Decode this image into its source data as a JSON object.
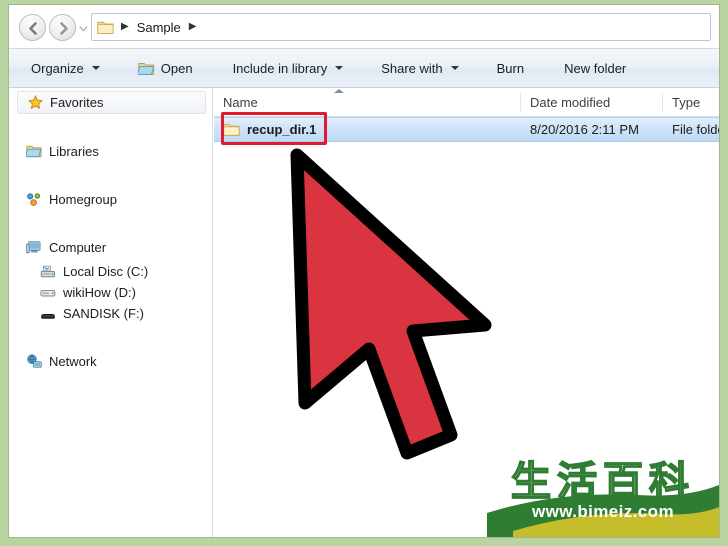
{
  "window": {
    "title": "Sample",
    "background_color": "#b9d4a0"
  },
  "address_bar": {
    "back_icon": "back-arrow-icon",
    "forward_icon": "forward-arrow-icon",
    "recent_pages_icon": "chevron-down-icon",
    "folder_icon": "folder-icon",
    "breadcrumb": [
      "Sample"
    ],
    "separator": "▶"
  },
  "toolbar": {
    "organize_label": "Organize",
    "open_label": "Open",
    "include_in_library_label": "Include in library",
    "share_with_label": "Share with",
    "burn_label": "Burn",
    "new_folder_label": "New folder",
    "open_icon": "open-folder-icon"
  },
  "sidebar": {
    "items": [
      {
        "label": "Favorites",
        "icon": "star-icon",
        "level": 0,
        "selected": true
      },
      {
        "label": "Libraries",
        "icon": "libraries-icon",
        "level": 0,
        "selected": false
      },
      {
        "label": "Homegroup",
        "icon": "homegroup-icon",
        "level": 0,
        "selected": false
      },
      {
        "label": "Computer",
        "icon": "computer-icon",
        "level": 0,
        "selected": false
      },
      {
        "label": "Local Disc (C:)",
        "icon": "hard-drive-icon",
        "level": 1,
        "selected": false
      },
      {
        "label": "wikiHow (D:)",
        "icon": "disc-drive-icon",
        "level": 1,
        "selected": false
      },
      {
        "label": "SANDISK (F:)",
        "icon": "usb-drive-icon",
        "level": 1,
        "selected": false
      },
      {
        "label": "Network",
        "icon": "network-icon",
        "level": 0,
        "selected": false
      }
    ]
  },
  "file_list": {
    "columns": [
      {
        "label": "Name",
        "sorted": true
      },
      {
        "label": "Date modified",
        "sorted": false
      },
      {
        "label": "Type",
        "sorted": false
      }
    ],
    "sort_direction": "ascending",
    "rows": [
      {
        "name": "recup_dir.1",
        "date_modified": "8/20/2016 2:11 PM",
        "type": "File folder",
        "icon": "folder-icon",
        "selected": true,
        "highlighted": true
      }
    ]
  },
  "annotations": {
    "highlight_box_color": "#e01b2e",
    "cursor": {
      "icon": "mouse-cursor-arrow",
      "fill_color": "#d9343f",
      "outline_color": "#000000"
    }
  },
  "watermark": {
    "text_cn": "生活百科",
    "url": "www.bimeiz.com",
    "swoosh_color": "#2e7d32",
    "accent_color": "#d4c22a"
  }
}
